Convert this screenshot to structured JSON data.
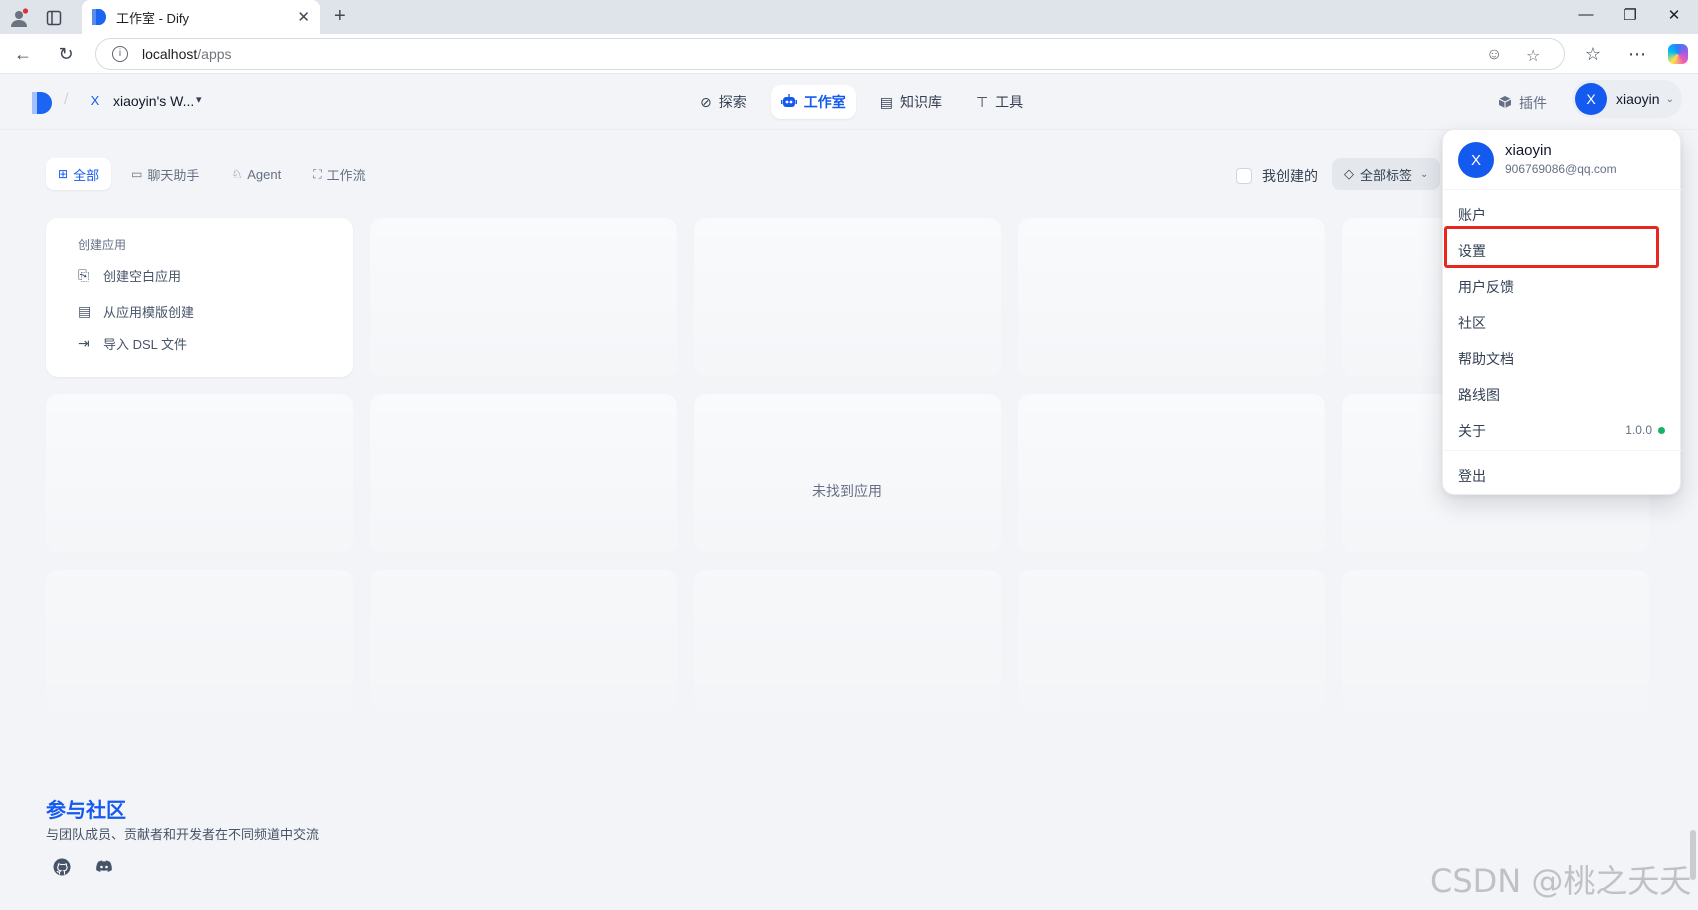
{
  "browser": {
    "tab_title": "工作室 - Dify",
    "url_host": "localhost",
    "url_path": "/apps"
  },
  "header": {
    "workspace_badge": "X",
    "workspace_name": "xiaoyin's W...",
    "nav": [
      {
        "label": "探索",
        "icon": "compass-icon"
      },
      {
        "label": "工作室",
        "icon": "robot-icon",
        "active": true
      },
      {
        "label": "知识库",
        "icon": "book-icon"
      },
      {
        "label": "工具",
        "icon": "hammer-icon"
      }
    ],
    "plugins_label": "插件",
    "user_initial": "X",
    "user_name": "xiaoyin"
  },
  "filters": {
    "tabs": [
      {
        "label": "全部",
        "icon": "grid-icon",
        "active": true
      },
      {
        "label": "聊天助手",
        "icon": "chat-icon"
      },
      {
        "label": "Agent",
        "icon": "agent-icon"
      },
      {
        "label": "工作流",
        "icon": "workflow-icon"
      }
    ],
    "created_by_me": "我创建的",
    "all_tags": "全部标签"
  },
  "create_card": {
    "title": "创建应用",
    "items": [
      {
        "label": "创建空白应用",
        "icon": "file-plus-icon"
      },
      {
        "label": "从应用模版创建",
        "icon": "template-icon"
      },
      {
        "label": "导入 DSL 文件",
        "icon": "import-icon"
      }
    ]
  },
  "empty_state": "未找到应用",
  "user_menu": {
    "initial": "X",
    "name": "xiaoyin",
    "email": "906769086@qq.com",
    "items": [
      "账户",
      "设置",
      "用户反馈",
      "社区",
      "帮助文档",
      "路线图",
      "关于"
    ],
    "version": "1.0.0",
    "logout": "登出",
    "highlighted_item": "设置"
  },
  "footer": {
    "title": "参与社区",
    "subtitle": "与团队成员、贡献者和开发者在不同频道中交流"
  },
  "watermark": "CSDN @桃之夭夭",
  "colors": {
    "accent": "#155aef",
    "highlight": "#e8271f",
    "status_ok": "#17b26a"
  }
}
